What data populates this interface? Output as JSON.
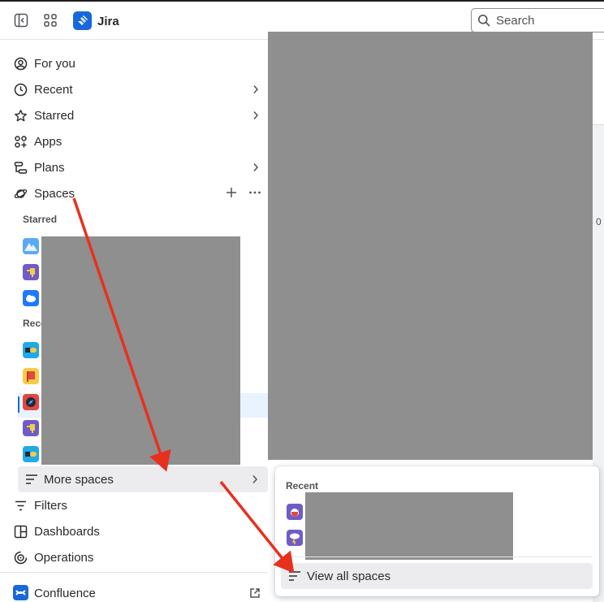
{
  "topbar": {
    "app_name": "Jira",
    "search_placeholder": "Search"
  },
  "sidebar": {
    "items": [
      {
        "label": "For you",
        "icon": "person-circle-icon"
      },
      {
        "label": "Recent",
        "icon": "clock-icon"
      },
      {
        "label": "Starred",
        "icon": "star-icon"
      },
      {
        "label": "Apps",
        "icon": "apps-icon"
      },
      {
        "label": "Plans",
        "icon": "plans-icon"
      },
      {
        "label": "Spaces",
        "icon": "planet-icon"
      }
    ],
    "starred_label": "Starred",
    "recent_label_partial": "Rece",
    "more_spaces_label": "More spaces",
    "lower_items": [
      {
        "label": "Filters",
        "icon": "filter-icon"
      },
      {
        "label": "Dashboards",
        "icon": "dashboard-icon"
      },
      {
        "label": "Operations",
        "icon": "operations-icon"
      }
    ],
    "confluence_label": "Confluence"
  },
  "popup": {
    "recent_label": "Recent",
    "view_all_label": "View all spaces"
  },
  "clipped_text": "0",
  "colors": {
    "brand": "#1868db",
    "annotation_arrow": "#e8301f",
    "redaction": "#8f8f8f"
  }
}
